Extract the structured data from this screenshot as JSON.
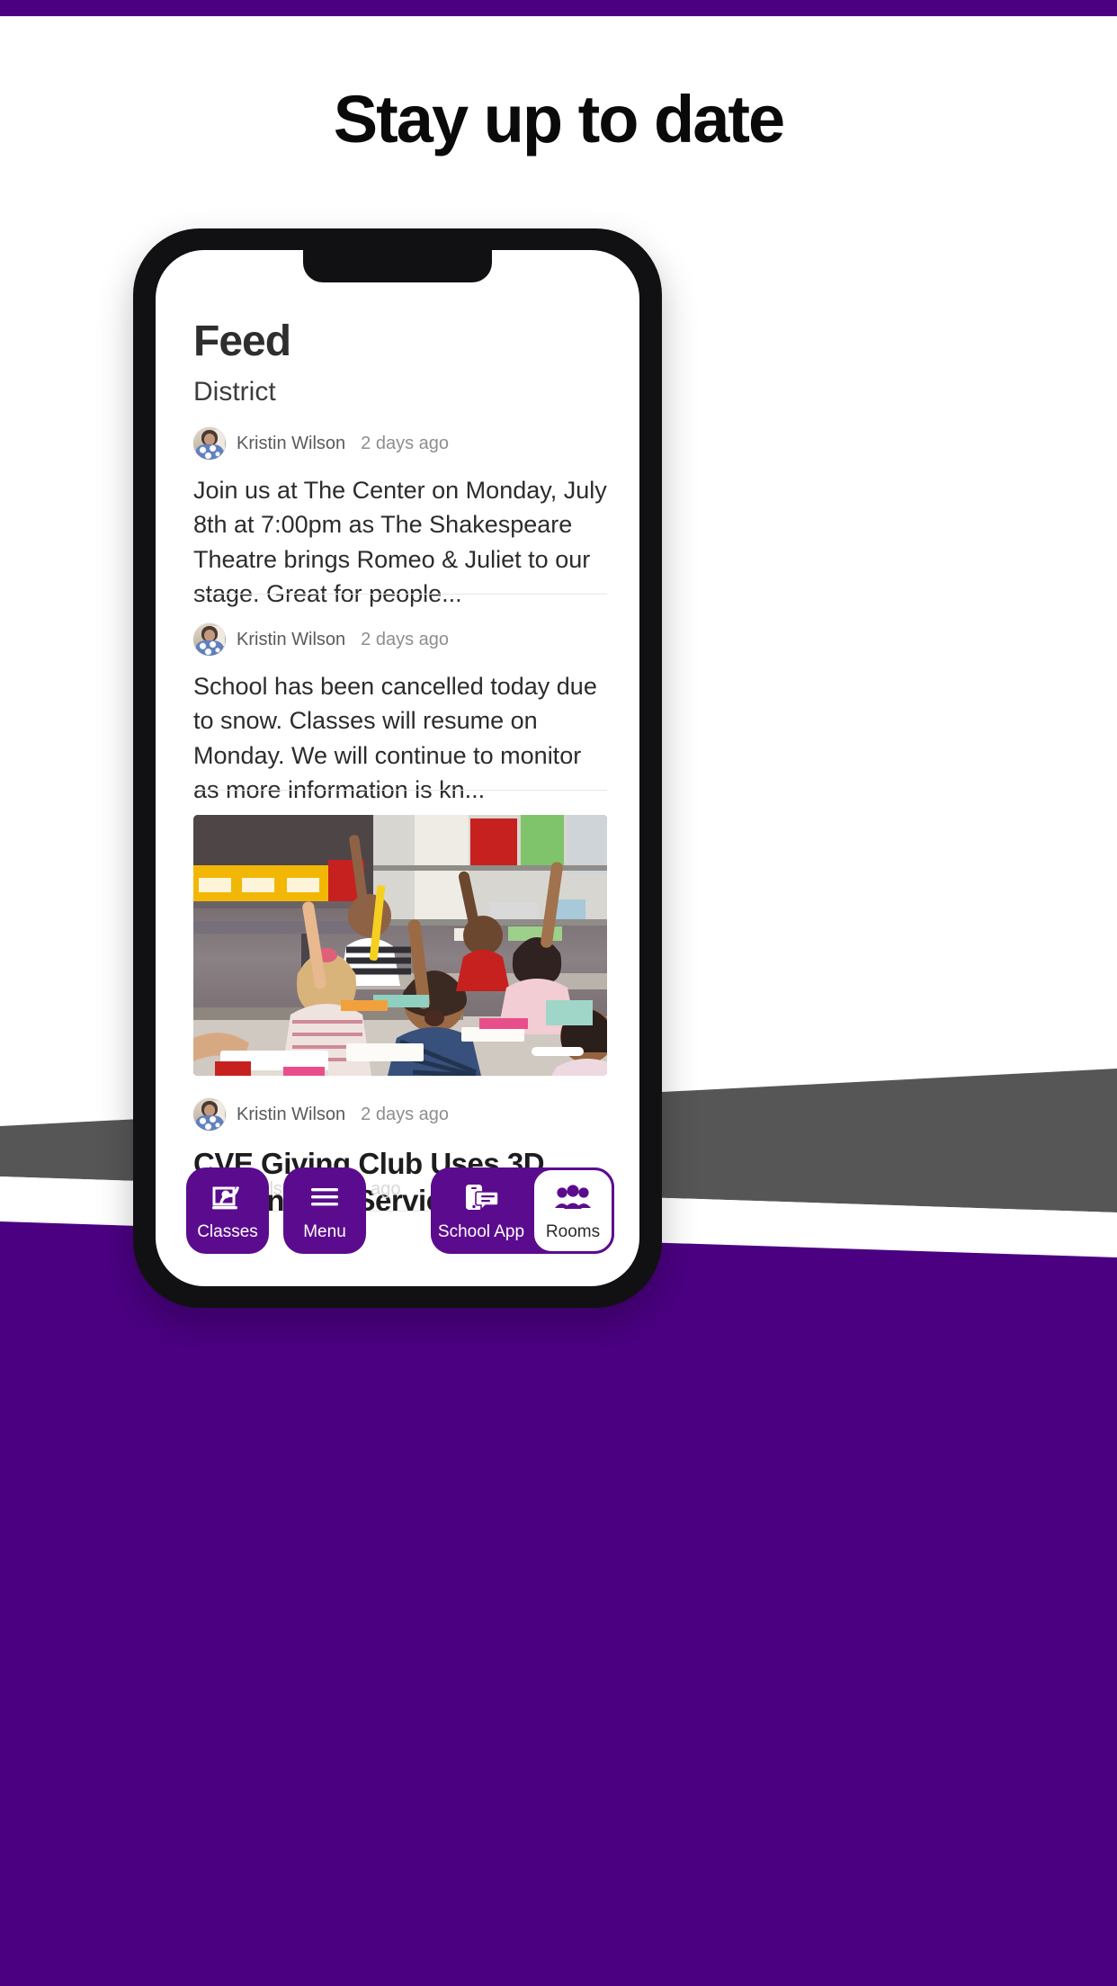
{
  "page": {
    "headline": "Stay up to date",
    "accent_purple": "#4b0082",
    "button_purple": "#5b0c8e",
    "shape_gray": "#565656",
    "background": "#ffffff"
  },
  "phone": {
    "feed": {
      "title": "Feed",
      "subtitle": "District",
      "posts": [
        {
          "author": "Kristin Wilson",
          "time": "2 days ago",
          "body": "Join us at The Center on Monday, July 8th at 7:00pm as The Shakespeare Theatre brings Romeo & Juliet to our stage. Great for people..."
        },
        {
          "author": "Kristin Wilson",
          "time": "2 days ago",
          "body": "School has been cancelled today due to snow. Classes will resume on Monday. We will continue to monitor as more information is kn..."
        },
        {
          "author": "Kristin Wilson",
          "time": "2 days ago",
          "title": "CVE Giving Club Uses 3D Printing for Service Projects",
          "image_alt": "classroom-photo-students-raising-hands"
        },
        {
          "author": "Kristin Wilson",
          "time": "2 days ago"
        }
      ]
    },
    "nav": {
      "items": [
        {
          "label": "Classes",
          "icon": "classes-icon",
          "active": false
        },
        {
          "label": "Menu",
          "icon": "hamburger-icon",
          "active": false
        },
        {
          "label": "School App",
          "icon": "school-app-icon",
          "active": false
        },
        {
          "label": "Rooms",
          "icon": "rooms-icon",
          "active": true
        }
      ]
    }
  }
}
